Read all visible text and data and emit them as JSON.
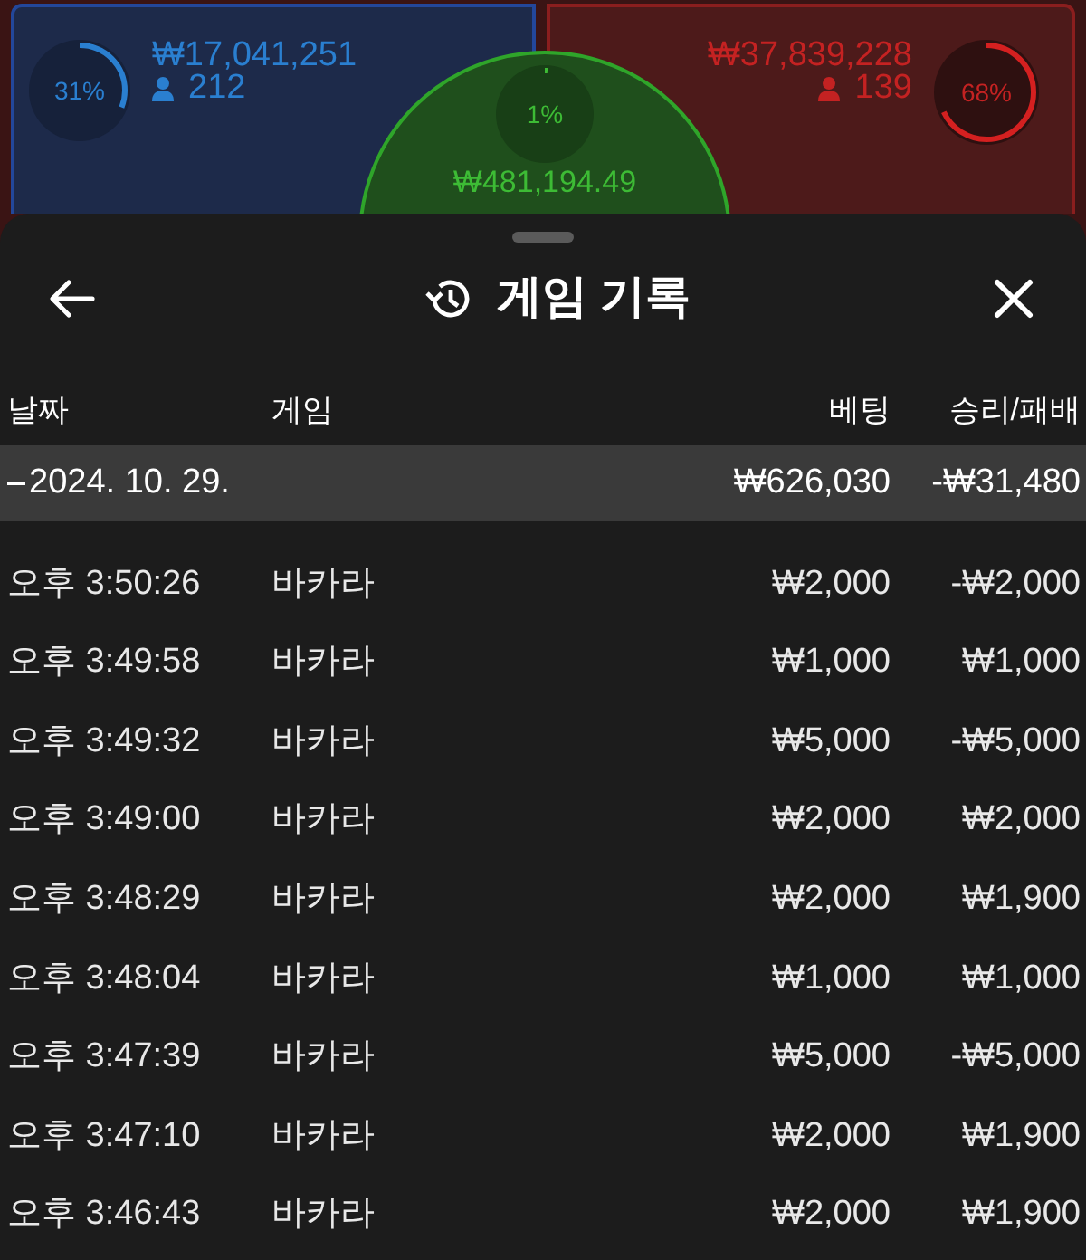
{
  "betting_board": {
    "player": {
      "percent": "31%",
      "amount": "₩17,041,251",
      "players": "212"
    },
    "tie": {
      "percent": "1%",
      "amount": "₩481,194.49"
    },
    "banker": {
      "percent": "68%",
      "amount": "₩37,839,228",
      "players": "139"
    }
  },
  "sheet": {
    "title": "게임 기록",
    "table": {
      "columns": [
        "날짜",
        "게임",
        "베팅",
        "승리/패배"
      ],
      "group": {
        "date": "2024. 10. 29.",
        "expanded": true,
        "bet": "₩626,030",
        "result": "-₩31,480"
      },
      "rows": [
        {
          "time": "오후 3:50:26",
          "game": "바카라",
          "bet": "₩2,000",
          "result": "-₩2,000"
        },
        {
          "time": "오후 3:49:58",
          "game": "바카라",
          "bet": "₩1,000",
          "result": "₩1,000"
        },
        {
          "time": "오후 3:49:32",
          "game": "바카라",
          "bet": "₩5,000",
          "result": "-₩5,000"
        },
        {
          "time": "오후 3:49:00",
          "game": "바카라",
          "bet": "₩2,000",
          "result": "₩2,000"
        },
        {
          "time": "오후 3:48:29",
          "game": "바카라",
          "bet": "₩2,000",
          "result": "₩1,900"
        },
        {
          "time": "오후 3:48:04",
          "game": "바카라",
          "bet": "₩1,000",
          "result": "₩1,000"
        },
        {
          "time": "오후 3:47:39",
          "game": "바카라",
          "bet": "₩5,000",
          "result": "-₩5,000"
        },
        {
          "time": "오후 3:47:10",
          "game": "바카라",
          "bet": "₩2,000",
          "result": "₩1,900"
        },
        {
          "time": "오후 3:46:43",
          "game": "바카라",
          "bet": "₩2,000",
          "result": "₩1,900"
        }
      ]
    }
  }
}
